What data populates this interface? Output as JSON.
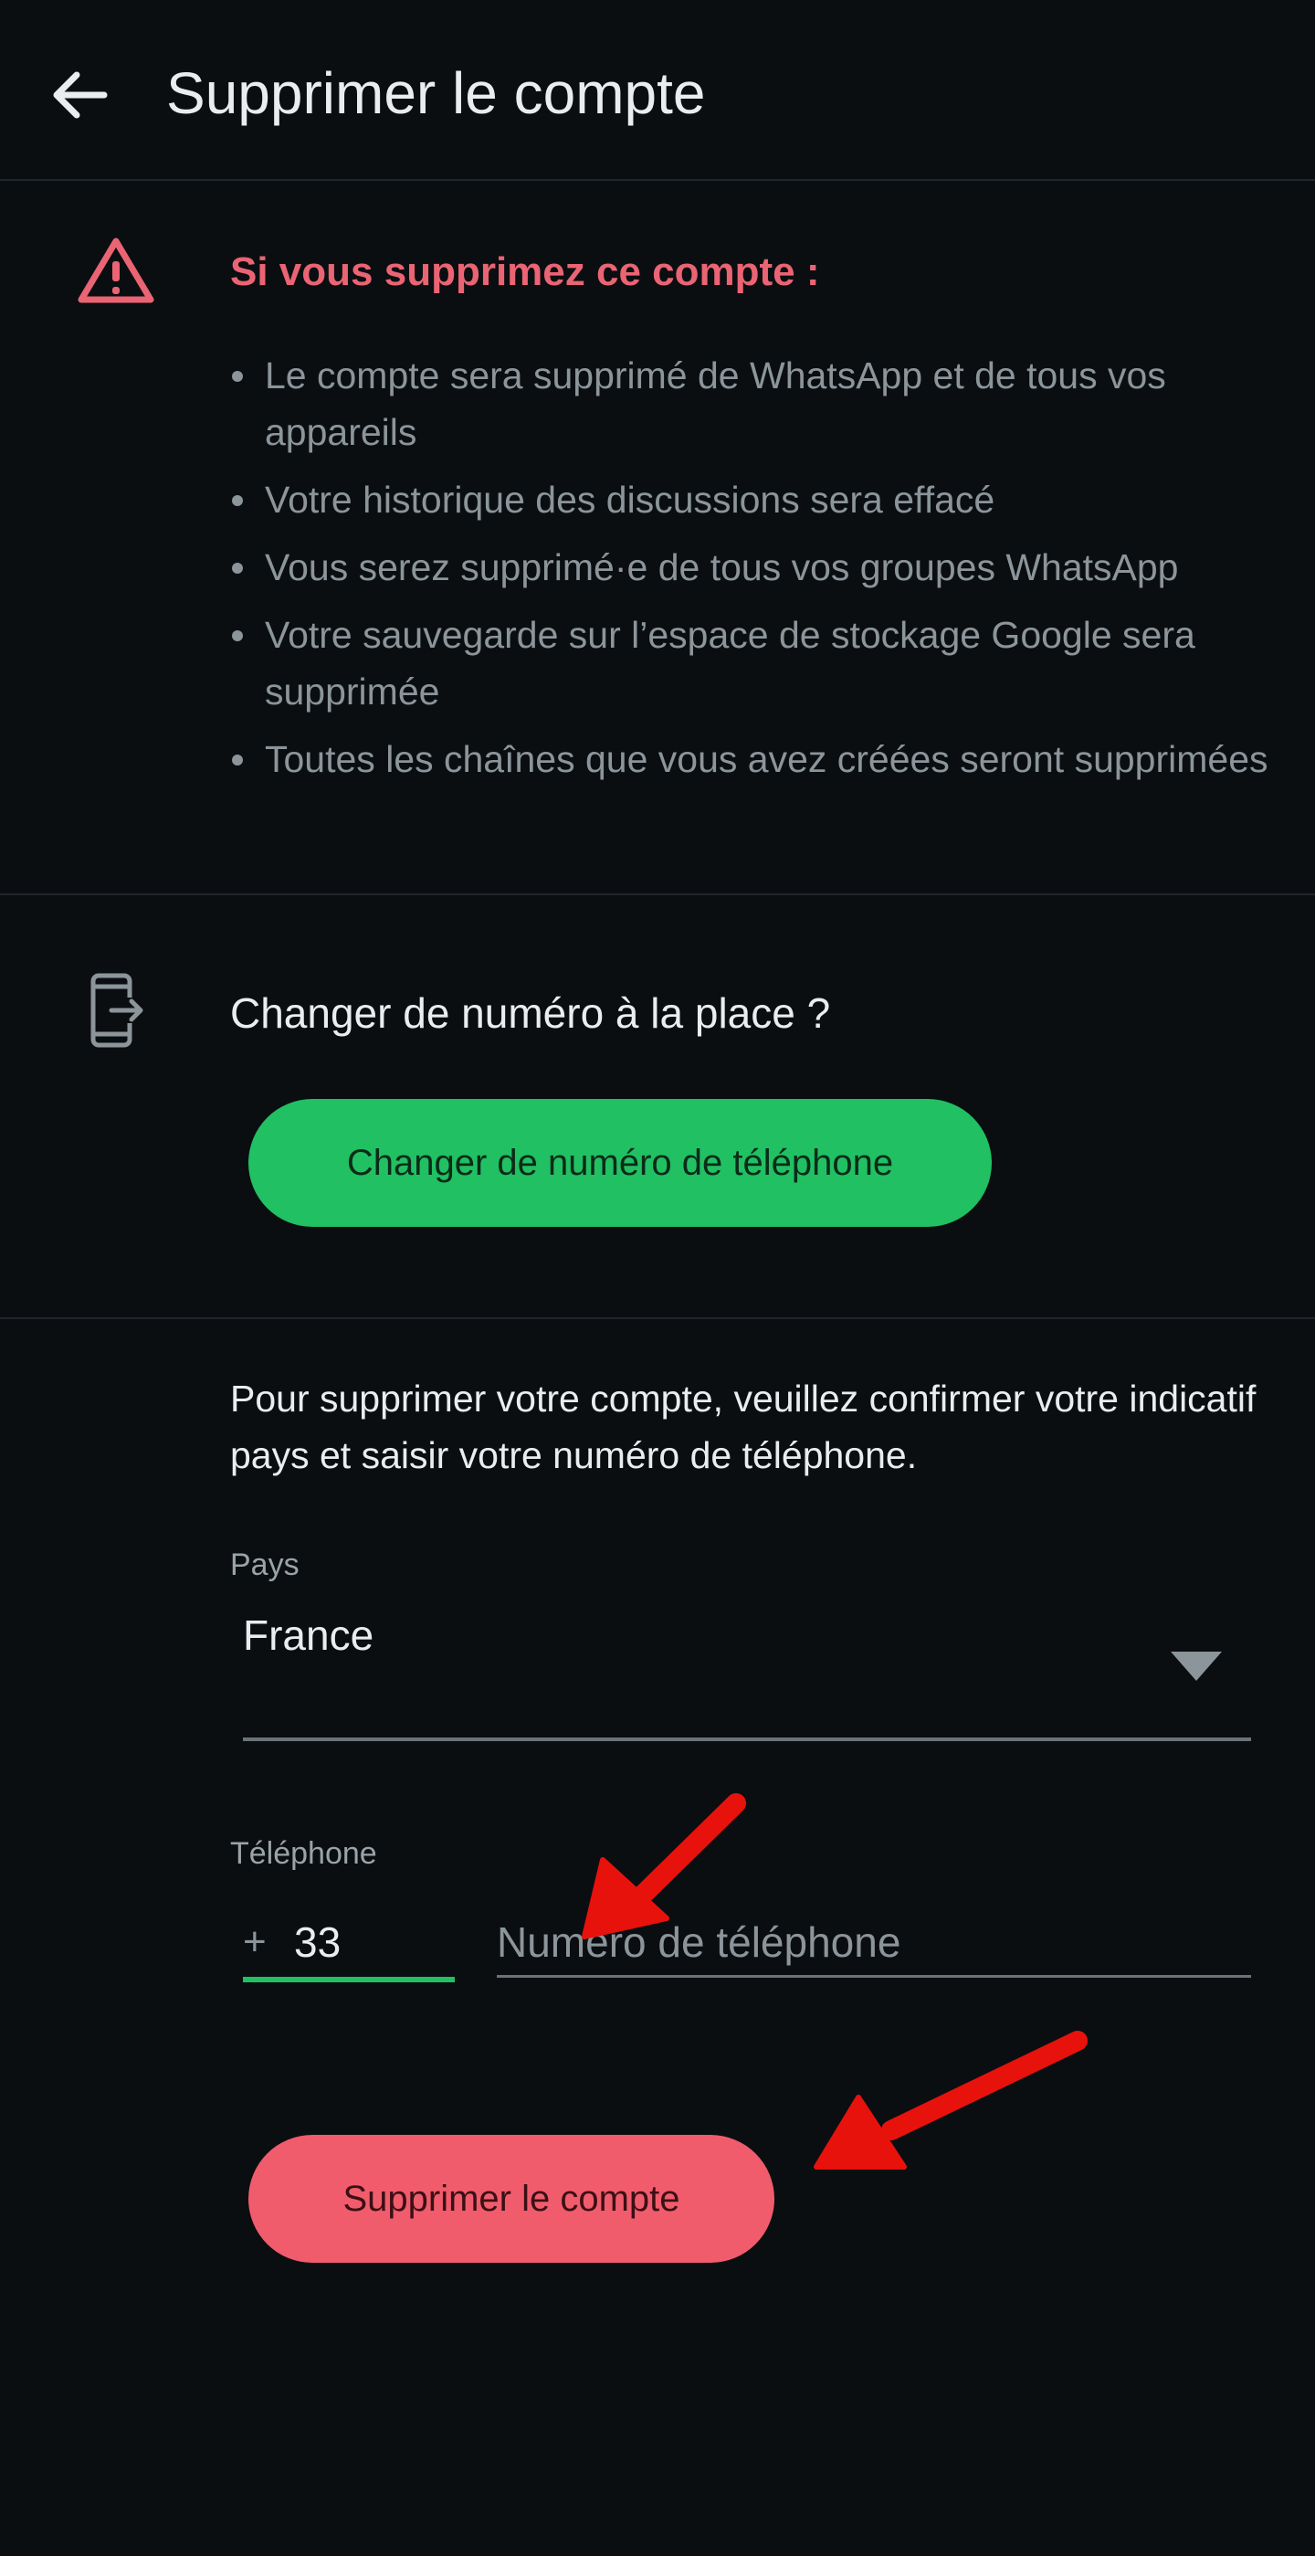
{
  "header": {
    "title": "Supprimer le compte",
    "back_icon": "arrow-left-icon"
  },
  "warning": {
    "icon": "warning-triangle-icon",
    "title": "Si vous supprimez ce compte :",
    "items": [
      "Le compte sera supprimé de WhatsApp et de tous vos appareils",
      "Votre historique des discussions sera effacé",
      "Vous serez supprimé·e de tous vos groupes WhatsApp",
      "Votre sauvegarde sur l’espace de stockage Google sera supprimée",
      "Toutes les chaînes que vous avez créées seront supprimées"
    ]
  },
  "change_number": {
    "icon": "phone-transfer-icon",
    "question": "Changer de numéro à la place ?",
    "button_label": "Changer de numéro de téléphone"
  },
  "form": {
    "instructions": "Pour supprimer votre compte, veuillez confirmer votre indicatif pays et saisir votre numéro de téléphone.",
    "country_label": "Pays",
    "country_value": "France",
    "phone_label": "Téléphone",
    "plus": "+",
    "country_code": "33",
    "phone_placeholder": "Numéro de téléphone",
    "delete_button_label": "Supprimer le compte"
  },
  "colors": {
    "background": "#0b0e11",
    "warning_red": "#ea6474",
    "accent_green": "#21c063",
    "delete_red": "#f15c6d",
    "annotation_arrow": "#e8120c"
  }
}
